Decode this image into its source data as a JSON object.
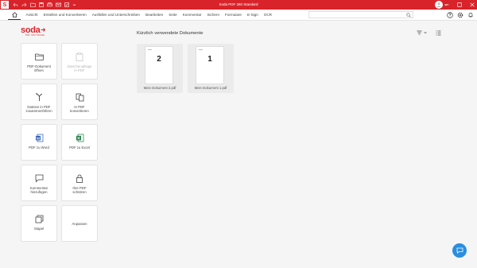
{
  "window": {
    "title": "Soda PDF 360 Standard",
    "app_icon_letter": "S",
    "accent_color": "#d8232a"
  },
  "menu": {
    "items": [
      "Ansicht",
      "Erstellen und Konvertieren",
      "Ausfüllen und Unterschreiben",
      "Bearbeiten",
      "Seite",
      "Kommentar",
      "Sichern",
      "Formulare",
      "E-Sign",
      "OCR"
    ]
  },
  "brand": {
    "name": "soda",
    "tagline": "PDF SOFTWARE"
  },
  "tiles": [
    {
      "label": "PDF-Dokument\nöffnen",
      "icon": "folder-icon"
    },
    {
      "label": "Zwischenablage\nin PDF",
      "icon": "clipboard-icon",
      "disabled": true
    },
    {
      "label": "Dateien in PDF\nzusammenführen",
      "icon": "merge-icon"
    },
    {
      "label": "In PDF\nkonvertieren",
      "icon": "convert-icon"
    },
    {
      "label": "PDF zu Word",
      "icon": "word-icon"
    },
    {
      "label": "PDF zu Excel",
      "icon": "excel-icon"
    },
    {
      "label": "Kommentar\nhinzufügen",
      "icon": "comment-icon"
    },
    {
      "label": "Ihre PDF\nschützen",
      "icon": "lock-icon"
    },
    {
      "label": "Stapel",
      "icon": "batch-icon"
    },
    {
      "label": "Anpassen",
      "icon": ""
    }
  ],
  "main": {
    "section_title": "Kürzlich verwendete Dokumente",
    "documents": [
      {
        "page_number": "2",
        "file_name": "Mein Dokument 2.pdf"
      },
      {
        "page_number": "1",
        "file_name": "Mein Dokument 1.pdf"
      }
    ]
  },
  "colors": {
    "word_blue": "#2b5fb4",
    "excel_green": "#1f7a43",
    "fab_blue": "#2a8ee0"
  }
}
